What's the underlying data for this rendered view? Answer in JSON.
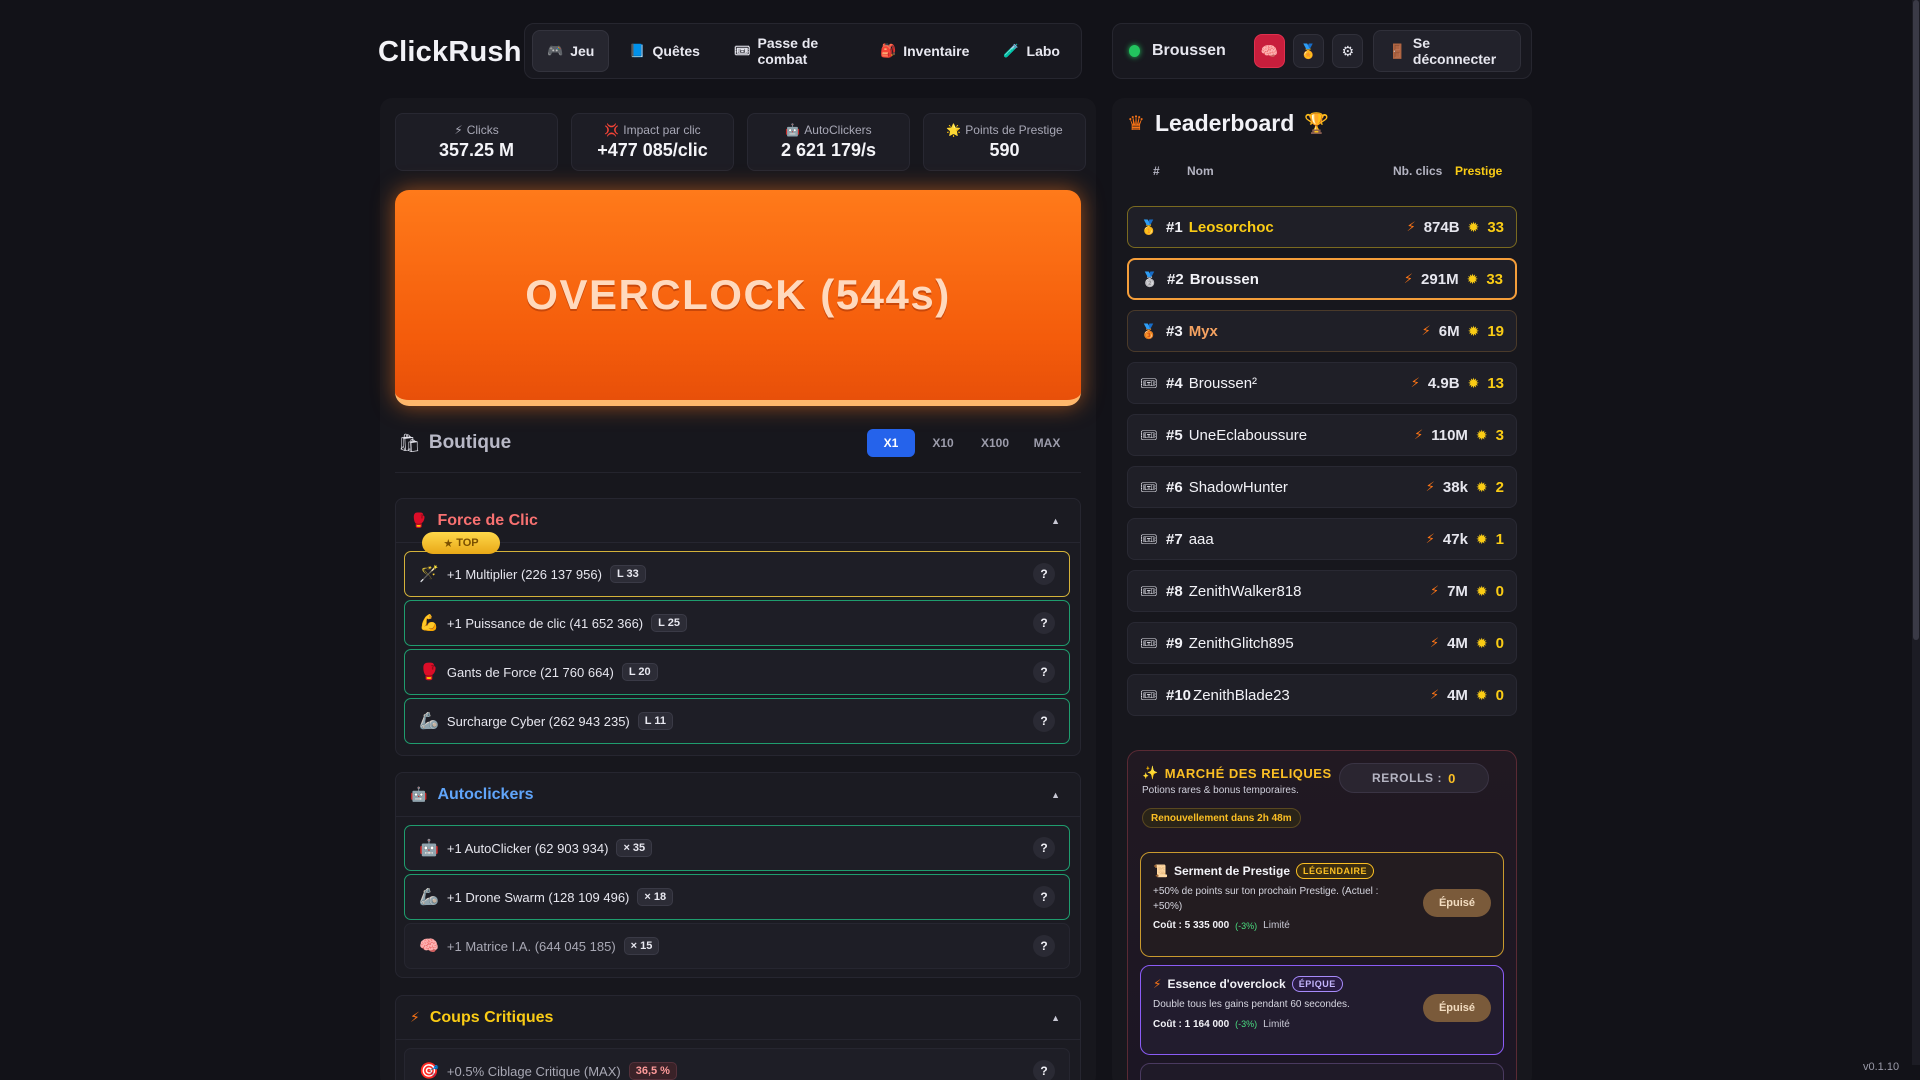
{
  "app": {
    "name": "ClickRush",
    "version": "v0.1.10"
  },
  "nav": {
    "tabs": [
      {
        "label": "Jeu",
        "icon": "🎮"
      },
      {
        "label": "Quêtes",
        "icon": "📘"
      },
      {
        "label": "Passe de combat",
        "icon": "🎟"
      },
      {
        "label": "Inventaire",
        "icon": "🎒"
      },
      {
        "label": "Labo",
        "icon": "🧪"
      }
    ]
  },
  "user": {
    "name": "Broussen",
    "logout_label": "Se déconnecter"
  },
  "stats": [
    {
      "label": "Clicks",
      "value": "357.25 M",
      "icon": "⚡"
    },
    {
      "label": "Impact par clic",
      "value": "+477 085/clic",
      "icon": "💢"
    },
    {
      "label": "AutoClickers",
      "value": "2 621 179/s",
      "icon": "🤖"
    },
    {
      "label": "Points de Prestige",
      "value": "590",
      "icon": "🌟"
    }
  ],
  "overclock": {
    "label": "OVERCLOCK (544s)"
  },
  "shop": {
    "title": "Boutique",
    "quantities": [
      "X1",
      "X10",
      "X100",
      "MAX"
    ],
    "active_quantity": "X1",
    "top_badge": "TOP",
    "sections": [
      {
        "title": "Force de Clic",
        "title_color": "#f87171",
        "items": [
          {
            "label": "+1 Multiplier (226 137 956)",
            "level": "L 33",
            "icon": "🪄"
          },
          {
            "label": "+1 Puissance de clic (41 652 366)",
            "level": "L 25",
            "icon": "💪"
          },
          {
            "label": "Gants de Force (21 760 664)",
            "level": "L 20",
            "icon": "🥊"
          },
          {
            "label": "Surcharge Cyber (262 943 235)",
            "level": "L 11",
            "icon": "🦾"
          }
        ]
      },
      {
        "title": "Autoclickers",
        "title_color": "#60a5fa",
        "items": [
          {
            "label": "+1 AutoClicker (62 903 934)",
            "level": "× 35",
            "icon": "🤖"
          },
          {
            "label": "+1 Drone Swarm (128 109 496)",
            "level": "× 18",
            "icon": "🦾"
          },
          {
            "label": "+1 Matrice I.A. (644 045 185)",
            "level": "× 15",
            "icon": "🧠"
          }
        ]
      },
      {
        "title": "Coups Critiques",
        "title_color": "#facc15",
        "items": [
          {
            "label": "+0.5% Ciblage Critique (MAX)",
            "level": "36,5 %",
            "icon": "🎯"
          }
        ]
      }
    ]
  },
  "leaderboard": {
    "title": "Leaderboard",
    "columns": {
      "rank": "#",
      "name": "Nom",
      "clicks": "Nb. clics",
      "prestige": "Prestige"
    },
    "rows": [
      {
        "rank": "#1",
        "name": "Leosorchoc",
        "clicks": "874B",
        "prestige": "33",
        "medal": "🥇"
      },
      {
        "rank": "#2",
        "name": "Broussen",
        "clicks": "291M",
        "prestige": "33",
        "medal": "🥈"
      },
      {
        "rank": "#3",
        "name": "Myx",
        "clicks": "6M",
        "prestige": "19",
        "medal": "🥉"
      },
      {
        "rank": "#4",
        "name": "Broussen²",
        "clicks": "4.9B",
        "prestige": "13",
        "medal": "🎟"
      },
      {
        "rank": "#5",
        "name": "UneEclaboussure",
        "clicks": "110M",
        "prestige": "3",
        "medal": "🎟"
      },
      {
        "rank": "#6",
        "name": "ShadowHunter",
        "clicks": "38k",
        "prestige": "2",
        "medal": "🎟"
      },
      {
        "rank": "#7",
        "name": "aaa",
        "clicks": "47k",
        "prestige": "1",
        "medal": "🎟"
      },
      {
        "rank": "#8",
        "name": "ZenithWalker818",
        "clicks": "7M",
        "prestige": "0",
        "medal": "🎟"
      },
      {
        "rank": "#9",
        "name": "ZenithGlitch895",
        "clicks": "4M",
        "prestige": "0",
        "medal": "🎟"
      },
      {
        "rank": "#10",
        "name": "ZenithBlade23",
        "clicks": "4M",
        "prestige": "0",
        "medal": "🎟"
      }
    ]
  },
  "market": {
    "title": "MARCHÉ DES RELIQUES",
    "subtitle": "Potions rares & bonus temporaires.",
    "rerolls_label": "REROLLS :",
    "rerolls_value": "0",
    "renewal": "Renouvellement dans 2h 48m",
    "relics": [
      {
        "name": "Serment de Prestige",
        "rarity": "LÉGENDAIRE",
        "description": "+50% de points sur ton prochain Prestige. (Actuel : +50%)",
        "cost": "Coût : 5 335 000",
        "discount": "(-3%)",
        "limit": "Limité",
        "button": "Épuisé",
        "icon": "📜"
      },
      {
        "name": "Essence d'overclock",
        "rarity": "ÉPIQUE",
        "description": "Double tous les gains pendant 60 secondes.",
        "cost": "Coût : 1 164 000",
        "discount": "(-3%)",
        "limit": "Limité",
        "button": "Épuisé",
        "icon": "⚡"
      }
    ]
  }
}
